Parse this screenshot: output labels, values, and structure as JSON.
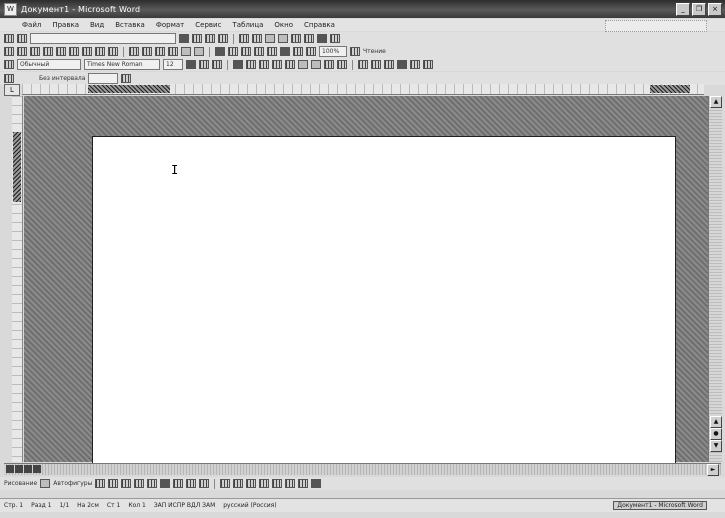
{
  "window": {
    "title": "Документ1 - Microsoft Word",
    "app_icon": "word-icon",
    "minimize_label": "_",
    "restore_label": "❐",
    "close_label": "×"
  },
  "menubar": {
    "items": [
      "Файл",
      "Правка",
      "Вид",
      "Вставка",
      "Формат",
      "Сервис",
      "Таблица",
      "Окно",
      "Справка"
    ]
  },
  "toolbar3": {
    "style_combo": "Обычный",
    "font_combo": "Times New Roman",
    "size_combo": "12"
  },
  "toolbar2": {
    "zoom_combo": "100%",
    "read_label": "Чтение"
  },
  "toolbar4": {
    "style_label": "Без интервала"
  },
  "ruler": {
    "corner": "L"
  },
  "document": {
    "cursor_char": "I"
  },
  "drawbar": {
    "draw_label": "Рисование",
    "autoshapes_label": "Автофигуры"
  },
  "statusbar": {
    "page": "Стр. 1",
    "section": "Разд 1",
    "pages": "1/1",
    "position": "На 2см",
    "line": "Ст 1",
    "column": "Кол 1",
    "modes": "ЗАП ИСПР ВДЛ ЗАМ",
    "language": "русский (Россия)",
    "document_status": "Документ1 - Microsoft Word"
  }
}
